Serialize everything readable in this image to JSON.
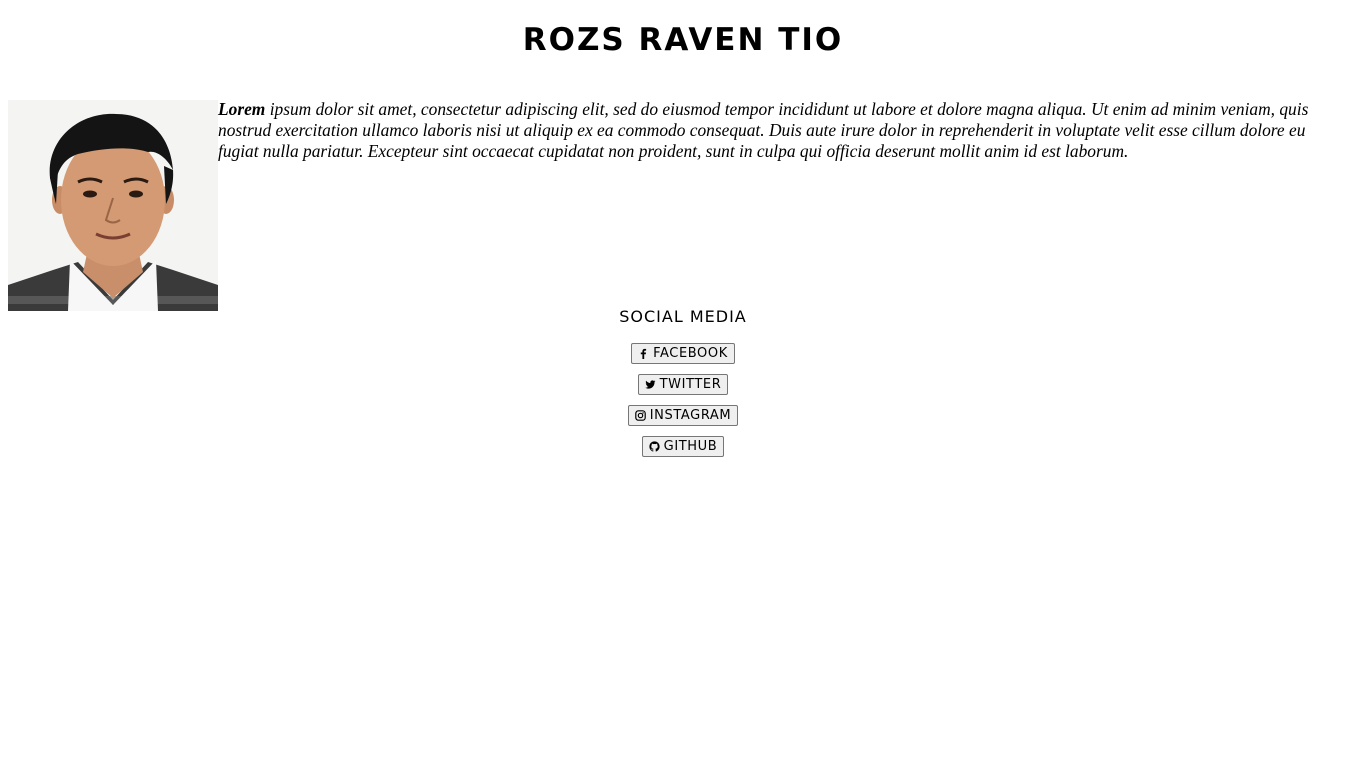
{
  "header": {
    "title": "ROZS RAVEN TIO"
  },
  "bio": {
    "lead": "Lorem",
    "text": " ipsum dolor sit amet, consectetur adipiscing elit, sed do eiusmod tempor incididunt ut labore et dolore magna aliqua. Ut enim ad minim veniam, quis nostrud exercitation ullamco laboris nisi ut aliquip ex ea commodo consequat. Duis aute irure dolor in reprehenderit in voluptate velit esse cillum dolore eu fugiat nulla pariatur. Excepteur sint occaecat cupidatat non proident, sunt in culpa qui officia deserunt mollit anim id est laborum."
  },
  "social": {
    "heading": "SOCIAL MEDIA",
    "buttons": [
      {
        "label": "FACEBOOK",
        "icon": "facebook-icon"
      },
      {
        "label": "TWITTER",
        "icon": "twitter-icon"
      },
      {
        "label": "INSTAGRAM",
        "icon": "instagram-icon"
      },
      {
        "label": "GITHUB",
        "icon": "github-icon"
      }
    ]
  }
}
